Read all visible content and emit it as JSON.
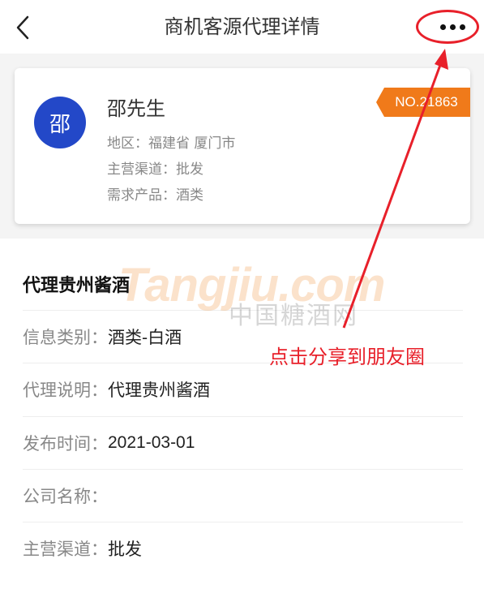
{
  "header": {
    "title": "商机客源代理详情"
  },
  "contact": {
    "avatar_char": "邵",
    "name": "邵先生",
    "region": "地区：福建省 厦门市",
    "channel": "主营渠道：批发",
    "product": "需求产品：酒类",
    "badge": "NO.21863"
  },
  "detail": {
    "title": "代理贵州酱酒",
    "rows": [
      {
        "label": "信息类别：",
        "value": "酒类-白酒"
      },
      {
        "label": "代理说明：",
        "value": "代理贵州酱酒"
      },
      {
        "label": "发布时间：",
        "value": "2021-03-01"
      },
      {
        "label": "公司名称：",
        "value": ""
      },
      {
        "label": "主营渠道：",
        "value": "批发"
      }
    ]
  },
  "watermark": {
    "logo": "Tangjiu.com",
    "text": "中国糖酒网"
  },
  "annotation": {
    "text": "点击分享到朋友圈",
    "color": "#e8202a"
  },
  "colors": {
    "avatar": "#2348c8",
    "badge": "#f07a1a"
  },
  "icons": {
    "back": "chevron-left-icon",
    "more": "more-horizontal-icon"
  }
}
